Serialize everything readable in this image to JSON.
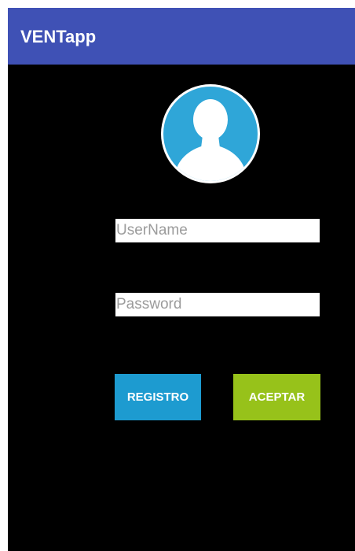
{
  "app_bar": {
    "title": "VENTapp",
    "color": "#3f51b5"
  },
  "avatar": {
    "icon": "user-silhouette-icon",
    "color": "#2fa6d8"
  },
  "form": {
    "username_placeholder": "UserName",
    "password_placeholder": "Password"
  },
  "buttons": {
    "registro_label": "REGISTRO",
    "registro_color": "#1d9bd0",
    "aceptar_label": "ACEPTAR",
    "aceptar_color": "#97c21a"
  }
}
